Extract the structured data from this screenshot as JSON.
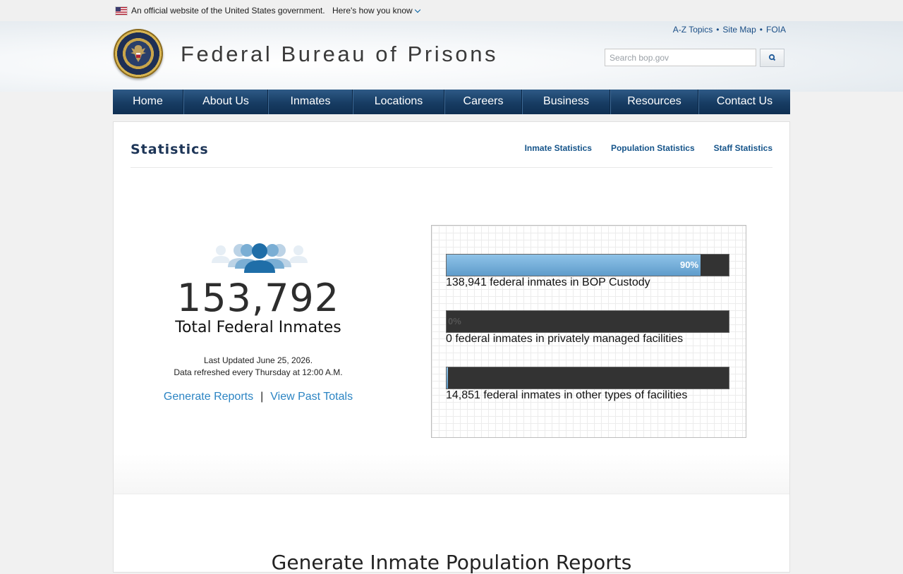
{
  "gov_banner": {
    "text": "An official website of the United States government.",
    "link": "Here's how you know"
  },
  "header": {
    "site_title": "Federal Bureau of Prisons",
    "util_links": [
      "A-Z Topics",
      "Site Map",
      "FOIA"
    ],
    "search_placeholder": "Search bop.gov"
  },
  "nav": {
    "items": [
      "Home",
      "About Us",
      "Inmates",
      "Locations",
      "Careers",
      "Business",
      "Resources",
      "Contact Us"
    ]
  },
  "statistics": {
    "title": "Statistics",
    "sub_links": [
      "Inmate Statistics",
      "Population Statistics",
      "Staff Statistics"
    ],
    "total_number": "153,792",
    "total_label": "Total Federal Inmates",
    "last_updated": "Last Updated June 25, 2026.",
    "refresh_note": "Data refreshed every Thursday at 12:00 A.M.",
    "generate_reports": "Generate Reports",
    "separator": "|",
    "view_past_totals": "View Past Totals"
  },
  "custody_bars": [
    {
      "percent_label": "90%",
      "fill_fraction": 0.9,
      "caption": "138,941 federal inmates in BOP Custody"
    },
    {
      "percent_label": "0%",
      "fill_fraction": 0.0,
      "caption": "0 federal inmates in privately managed facilities"
    },
    {
      "percent_label": "",
      "fill_fraction": 0.0,
      "caption": "14,851 federal inmates in other types of facilities"
    }
  ],
  "lower_section": {
    "heading": "Generate Inmate Population Reports"
  },
  "colors": {
    "nav_blue": "#173c63",
    "link_blue": "#2b84c3",
    "bar_fill": "#6fa9d6",
    "bar_track": "#333333"
  }
}
